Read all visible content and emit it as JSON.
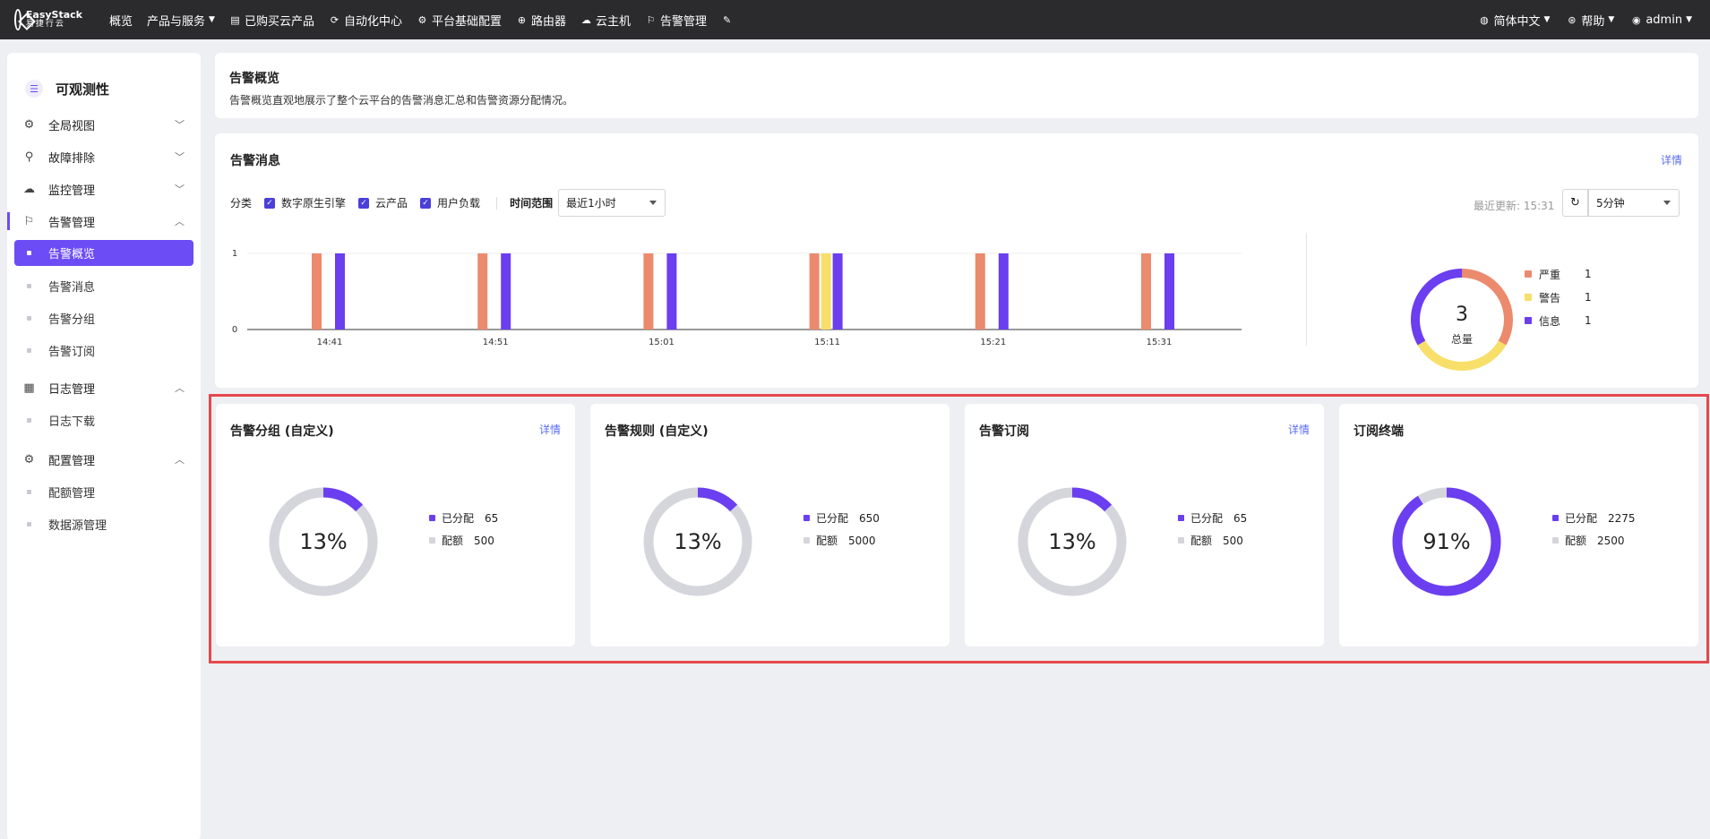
{
  "topnav": {
    "logo_line1": "EasyStack",
    "logo_line2": "易捷行云",
    "items": [
      {
        "label": "概览",
        "icon": "none"
      },
      {
        "label": "产品与服务",
        "icon": "none",
        "dropdown": true
      },
      {
        "label": "已购买云产品",
        "icon": "list-icon"
      },
      {
        "label": "自动化中心",
        "icon": "automation-icon"
      },
      {
        "label": "平台基础配置",
        "icon": "settings-icon"
      },
      {
        "label": "路由器",
        "icon": "router-icon"
      },
      {
        "label": "云主机",
        "icon": "cloud-icon"
      },
      {
        "label": "告警管理",
        "icon": "alarm-icon"
      }
    ],
    "right": {
      "language": "简体中文",
      "help": "帮助",
      "user": "admin"
    }
  },
  "sidebar": {
    "title": "可观测性",
    "groups": [
      {
        "label": "全局视图",
        "expanded": false,
        "items": []
      },
      {
        "label": "故障排除",
        "expanded": false,
        "items": []
      },
      {
        "label": "监控管理",
        "expanded": false,
        "items": []
      },
      {
        "label": "告警管理",
        "expanded": true,
        "items": [
          "告警概览",
          "告警消息",
          "告警分组",
          "告警订阅"
        ]
      },
      {
        "label": "日志管理",
        "expanded": true,
        "items": [
          "日志下载"
        ]
      },
      {
        "label": "配置管理",
        "expanded": true,
        "items": [
          "配额管理",
          "数据源管理"
        ]
      }
    ],
    "selected": "告警概览"
  },
  "overview": {
    "title": "告警概览",
    "description": "告警概览直观地展示了整个云平台的告警消息汇总和告警资源分配情况。"
  },
  "alarm_messages": {
    "title": "告警消息",
    "detail_link": "详情",
    "filter_label": "分类",
    "categories": [
      "数字原生引擎",
      "云产品",
      "用户负载"
    ],
    "time_range_label": "时间范围",
    "time_range_value": "最近1小时",
    "last_updated": "最近更新: 15:31",
    "refresh_interval": "5分钟",
    "summary": {
      "total": "3",
      "total_label": "总量",
      "levels": [
        {
          "name": "严重",
          "count": 1,
          "color": "#ec8a6d"
        },
        {
          "name": "警告",
          "count": 1,
          "color": "#f7df6a"
        },
        {
          "name": "信息",
          "count": 1,
          "color": "#6b3ef0"
        }
      ]
    }
  },
  "chart_data": {
    "type": "bar",
    "categories": [
      "14:41",
      "14:51",
      "15:01",
      "15:11",
      "15:21",
      "15:31"
    ],
    "series": [
      {
        "name": "严重",
        "values": [
          1,
          1,
          1,
          1,
          1,
          1
        ],
        "color": "#ec8a6d"
      },
      {
        "name": "警告",
        "values": [
          0,
          0,
          0,
          1,
          0,
          0
        ],
        "color": "#f7df6a"
      },
      {
        "name": "信息",
        "values": [
          1,
          1,
          1,
          1,
          1,
          1
        ],
        "color": "#6b3ef0"
      }
    ],
    "yticks": [
      "0",
      "1"
    ],
    "ylim": [
      0,
      1
    ],
    "grid": true
  },
  "quotas": [
    {
      "title": "告警分组 (自定义)",
      "detail_link": "详情",
      "percent": "13%",
      "fraction": 0.13,
      "allocated_label": "已分配",
      "allocated": "65",
      "quota_label": "配额",
      "quota": "500"
    },
    {
      "title": "告警规则 (自定义)",
      "detail_link": "",
      "percent": "13%",
      "fraction": 0.13,
      "allocated_label": "已分配",
      "allocated": "650",
      "quota_label": "配额",
      "quota": "5000"
    },
    {
      "title": "告警订阅",
      "detail_link": "详情",
      "percent": "13%",
      "fraction": 0.13,
      "allocated_label": "已分配",
      "allocated": "65",
      "quota_label": "配额",
      "quota": "500"
    },
    {
      "title": "订阅终端",
      "detail_link": "",
      "percent": "91%",
      "fraction": 0.91,
      "allocated_label": "已分配",
      "allocated": "2275",
      "quota_label": "配额",
      "quota": "2500"
    }
  ],
  "colors": {
    "accent": "#6b4cf5",
    "quota_fill": "#6b3ef0",
    "quota_track": "#d5d5dc",
    "highlight": "#e5484d"
  }
}
